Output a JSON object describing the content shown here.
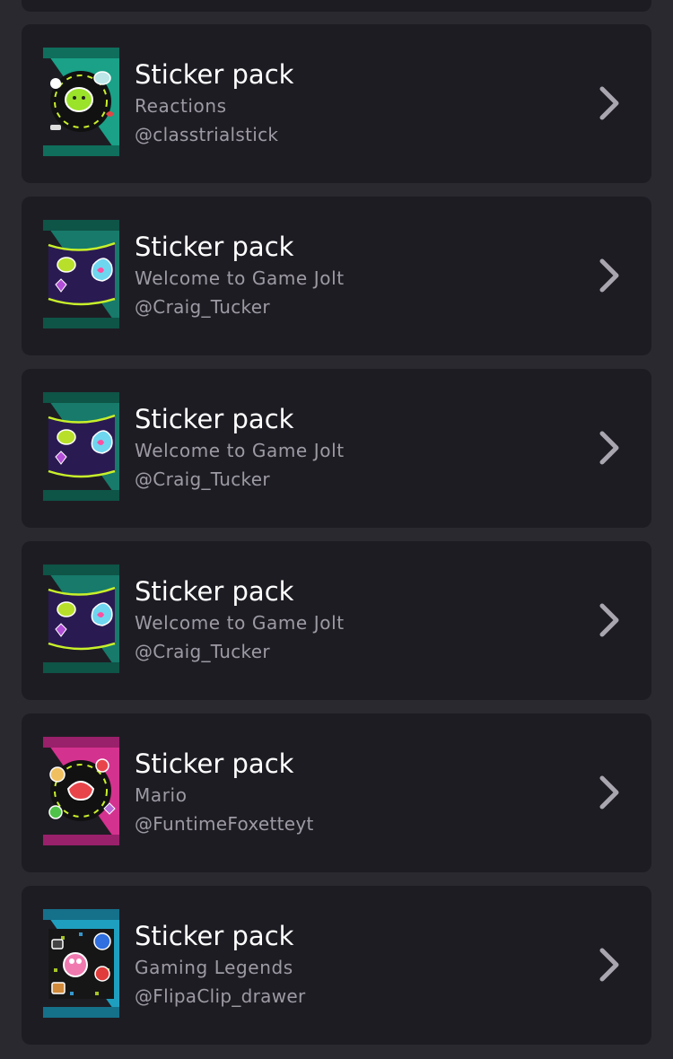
{
  "sticker_packs": [
    {
      "title": "Sticker pack",
      "name": "Reactions",
      "author": "@classtrialstick",
      "wrapper_color": "#1aa187",
      "wrapper_dark": "#0f6e5c",
      "art": "reactions-stickers"
    },
    {
      "title": "Sticker pack",
      "name": "Welcome to Game Jolt",
      "author": "@Craig_Tucker",
      "wrapper_color": "#177a6a",
      "wrapper_dark": "#0e5447",
      "art": "welcome-stickers"
    },
    {
      "title": "Sticker pack",
      "name": "Welcome to Game Jolt",
      "author": "@Craig_Tucker",
      "wrapper_color": "#177a6a",
      "wrapper_dark": "#0e5447",
      "art": "welcome-stickers"
    },
    {
      "title": "Sticker pack",
      "name": "Welcome to Game Jolt",
      "author": "@Craig_Tucker",
      "wrapper_color": "#177a6a",
      "wrapper_dark": "#0e5447",
      "art": "welcome-stickers"
    },
    {
      "title": "Sticker pack",
      "name": "Mario",
      "author": "@FuntimeFoxetteyt",
      "wrapper_color": "#d4328f",
      "wrapper_dark": "#99206a",
      "art": "mario-stickers"
    },
    {
      "title": "Sticker pack",
      "name": "Gaming Legends",
      "author": "@FlipaClip_drawer",
      "wrapper_color": "#1f9fbf",
      "wrapper_dark": "#15708a",
      "art": "gaming-legends-stickers"
    }
  ],
  "colors": {
    "background": "#2b2930",
    "card": "#1e1c23",
    "title": "#ffffff",
    "muted_text": "#9d9aa4",
    "chevron": "#a9a6b0",
    "accent_lime": "#c8f02a"
  },
  "icons": {
    "chevron": "chevron-right-icon",
    "pack": "sticker-pack-icon"
  }
}
